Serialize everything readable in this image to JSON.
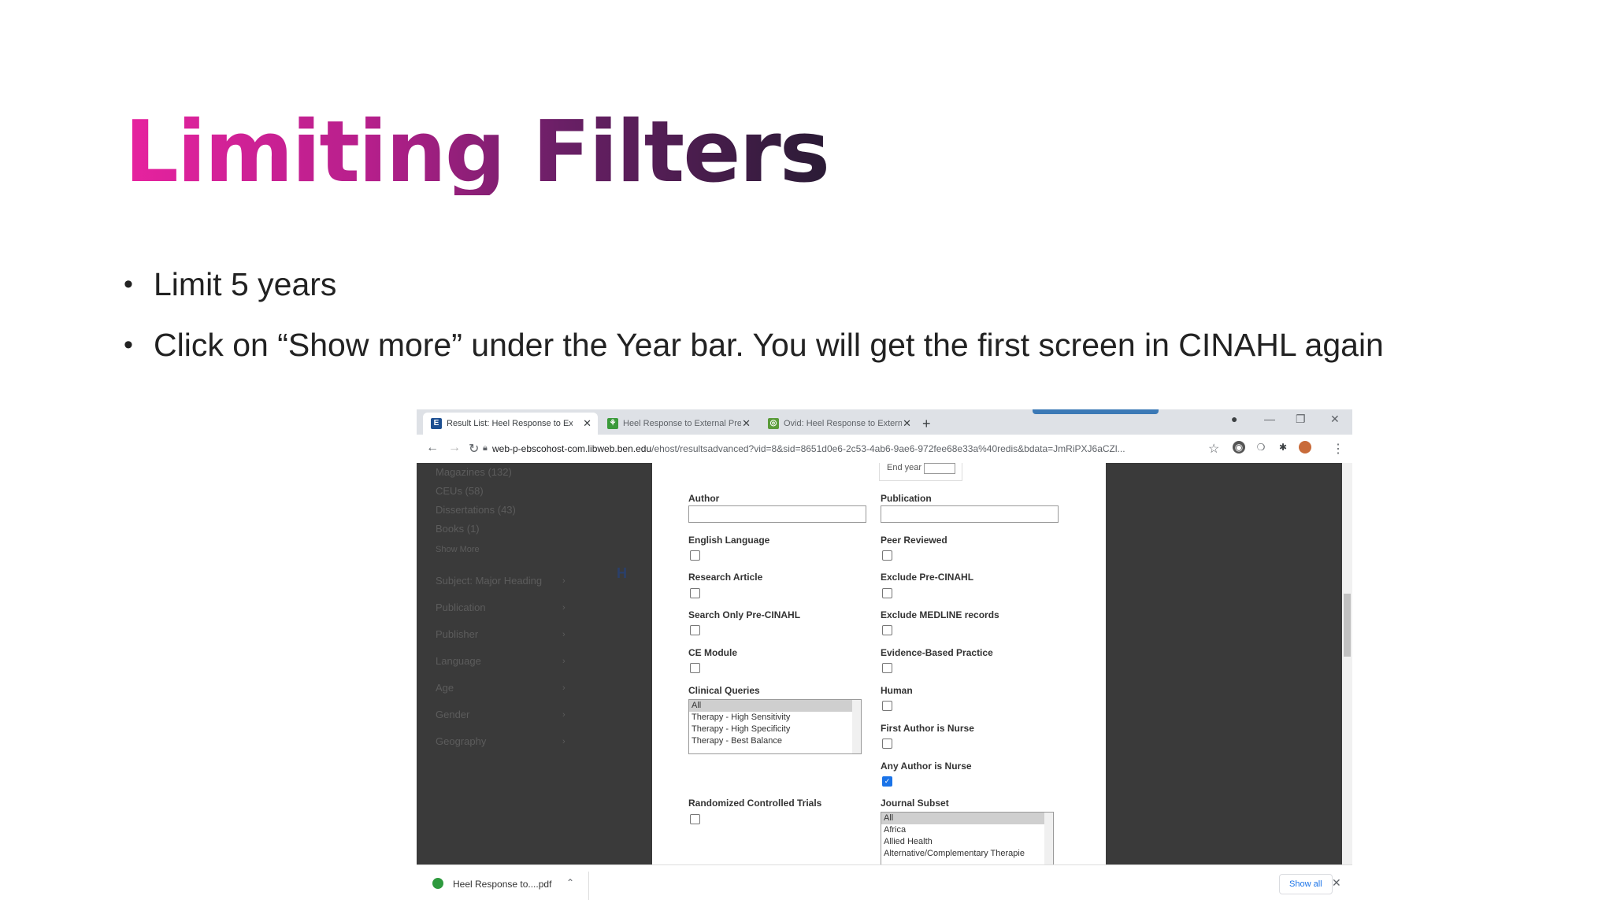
{
  "slide": {
    "title": "Limiting Filters",
    "bullets": [
      "Limit 5 years",
      "Click on “Show more” under the Year bar. You will get the first screen in CINAHL again"
    ]
  },
  "browser": {
    "tabs": [
      {
        "title": "Result List: Heel Response to Ext",
        "favicon": "ebsco-favicon",
        "active": true
      },
      {
        "title": "Heel Response to External Press",
        "favicon": "green-favicon",
        "active": false
      },
      {
        "title": "Ovid: Heel Response to External",
        "favicon": "ovid-favicon",
        "active": false
      }
    ],
    "new_tab": "+",
    "url_host": "web-p-ebscohost-com.libweb.ben.edu",
    "url_path": "/ehost/resultsadvanced?vid=8&sid=8651d0e6-2c53-4ab6-9ae6-972fee68e33a%40redis&bdata=JmRiPXJ6aCZl...",
    "accent_color": "#3b79b6"
  },
  "background_page": {
    "left_items": [
      "Magazines (132)",
      "CEUs (58)",
      "Dissertations (43)",
      "Books (1)",
      "Show More"
    ],
    "left_headings": [
      "Subject: Major Heading",
      "Publication",
      "Publisher",
      "Language",
      "Age",
      "Gender",
      "Geography"
    ]
  },
  "modal": {
    "end_year_label": "End year",
    "author_label": "Author",
    "publication_label": "Publication",
    "left_fields": [
      {
        "label": "English Language",
        "checked": false
      },
      {
        "label": "Research Article",
        "checked": false
      },
      {
        "label": "Search Only Pre-CINAHL",
        "checked": false
      },
      {
        "label": "CE Module",
        "checked": false
      }
    ],
    "right_fields": [
      {
        "label": "Peer Reviewed",
        "checked": false
      },
      {
        "label": "Exclude Pre-CINAHL",
        "checked": false
      },
      {
        "label": "Exclude MEDLINE records",
        "checked": false
      },
      {
        "label": "Evidence-Based Practice",
        "checked": false
      },
      {
        "label": "Human",
        "checked": false
      },
      {
        "label": "First Author is Nurse",
        "checked": false
      },
      {
        "label": "Any Author is Nurse",
        "checked": true
      }
    ],
    "clinical_queries": {
      "label": "Clinical Queries",
      "options": [
        "All",
        "Therapy - High Sensitivity",
        "Therapy - High Specificity",
        "Therapy - Best Balance"
      ]
    },
    "rct": {
      "label": "Randomized Controlled Trials",
      "checked": false
    },
    "journal_subset": {
      "label": "Journal Subset",
      "options": [
        "All",
        "Africa",
        "Allied Health",
        "Alternative/Complementary Therapie"
      ]
    }
  },
  "downloads": {
    "file": "Heel Response to....pdf",
    "show_all": "Show all"
  }
}
